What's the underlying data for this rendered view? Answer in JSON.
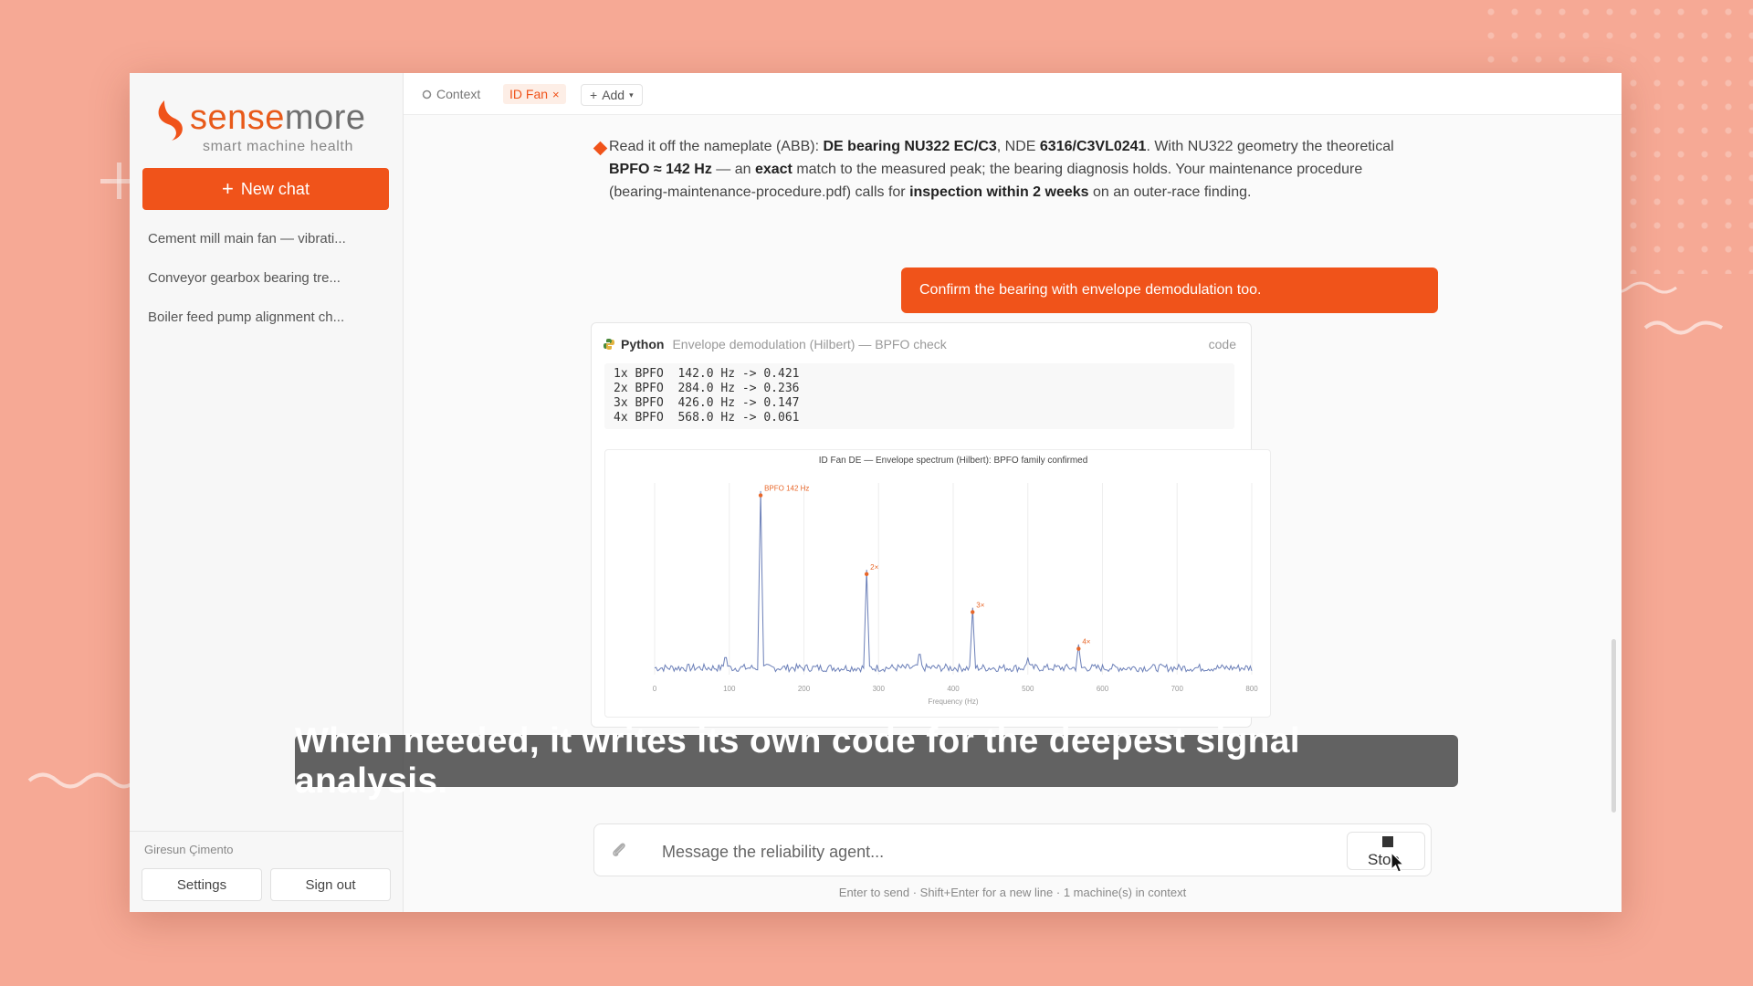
{
  "brand": {
    "name_left": "sense",
    "name_right": "more",
    "tagline": "smart machine health"
  },
  "sidebar": {
    "new_chat_label": "New chat",
    "chats": [
      {
        "label": "Cement mill main fan — vibrati..."
      },
      {
        "label": "Conveyor gearbox bearing tre..."
      },
      {
        "label": "Boiler feed pump alignment ch..."
      }
    ],
    "org_name": "Giresun Çimento",
    "settings_label": "Settings",
    "signout_label": "Sign out"
  },
  "tabs": {
    "context_label": "Context",
    "machine_label": "ID Fan",
    "add_label": "Add"
  },
  "assistant": {
    "p1": "Read it off the nameplate (ABB): ",
    "b1": "DE bearing NU322 EC/C3",
    "p2": ", NDE ",
    "b2": "6316/C3VL0241",
    "p3": ". With NU322 geometry the theoretical ",
    "b3": "BPFO ≈ 142 Hz",
    "p4": " — an ",
    "b4": "exact",
    "p5": " match to the measured peak; the bearing diagnosis holds. Your maintenance procedure (bearing-maintenance-procedure.pdf) calls for ",
    "b5": "inspection within 2 weeks",
    "p6": " on an outer-race finding."
  },
  "user_message": "Confirm the bearing with envelope demodulation too.",
  "code_card": {
    "language": "Python",
    "title": "Envelope demodulation (Hilbert) — BPFO check",
    "toggle_label": "code",
    "output_lines": [
      "1x BPFO  142.0 Hz -> 0.421",
      "2x BPFO  284.0 Hz -> 0.236",
      "3x BPFO  426.0 Hz -> 0.147",
      "4x BPFO  568.0 Hz -> 0.061"
    ]
  },
  "chart_data": {
    "type": "line",
    "title": "ID Fan DE — Envelope spectrum (Hilbert): BPFO family confirmed",
    "xlabel": "Frequency (Hz)",
    "ylabel": "",
    "xlim": [
      0,
      800
    ],
    "ylim": [
      0,
      0.45
    ],
    "xticks": [
      0,
      100,
      200,
      300,
      400,
      500,
      600,
      700,
      800
    ],
    "grid": true,
    "peaks": [
      {
        "x": 142,
        "y": 0.421,
        "label": "BPFO 142 Hz"
      },
      {
        "x": 284,
        "y": 0.236,
        "label": "2×"
      },
      {
        "x": 426,
        "y": 0.147,
        "label": "3×"
      },
      {
        "x": 568,
        "y": 0.061,
        "label": "4×"
      }
    ],
    "minor_peaks": [
      {
        "x": 95,
        "y": 0.04
      },
      {
        "x": 355,
        "y": 0.05
      },
      {
        "x": 500,
        "y": 0.03
      }
    ],
    "noise_floor": 0.02,
    "colors": {
      "line": "#6b7fb8",
      "marker": "#e8672a"
    }
  },
  "caption": "When needed, it writes its own code for the deepest signal analysis.",
  "composer": {
    "placeholder": "Message the reliability agent...",
    "stop_label": "Stop",
    "hint": "Enter to send · Shift+Enter for a new line · 1 machine(s) in context"
  },
  "colors": {
    "accent": "#f0531a",
    "background": "#f6a995"
  }
}
